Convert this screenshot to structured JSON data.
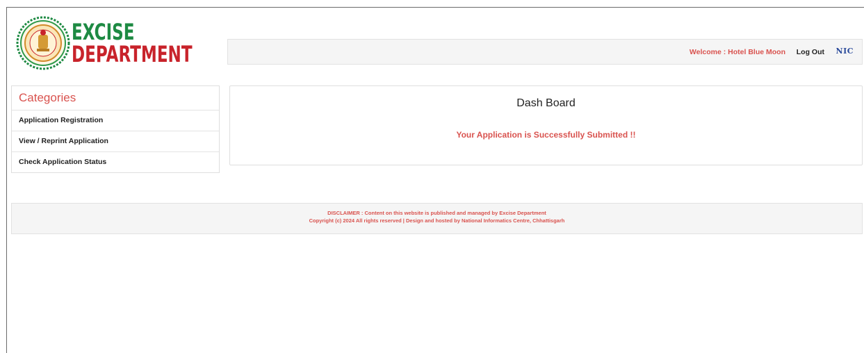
{
  "logo": {
    "line1": "EXCISE",
    "line2": "DEPARTMENT",
    "colors": {
      "green": "#1e8a43",
      "red": "#c8232b"
    },
    "seal_icon": "state-emblem-seal"
  },
  "header": {
    "welcome": "Welcome : Hotel Blue Moon",
    "logout": "Log Out",
    "nic": "NIC"
  },
  "sidebar": {
    "title": "Categories",
    "items": [
      {
        "label": "Application Registration"
      },
      {
        "label": "View / Reprint Application"
      },
      {
        "label": "Check Application Status"
      }
    ]
  },
  "main": {
    "title": "Dash Board",
    "message": "Your Application is Successfully Submitted !!"
  },
  "footer": {
    "line1": "DISCLAIMER : Content on this website is published and managed by Excise Department",
    "line2": "Copyright (c) 2024 All rights reserved | Design and hosted by National Informatics Centre, Chhattisgarh"
  },
  "colors": {
    "accent": "#d9534f",
    "bar_bg": "#f5f5f5"
  }
}
